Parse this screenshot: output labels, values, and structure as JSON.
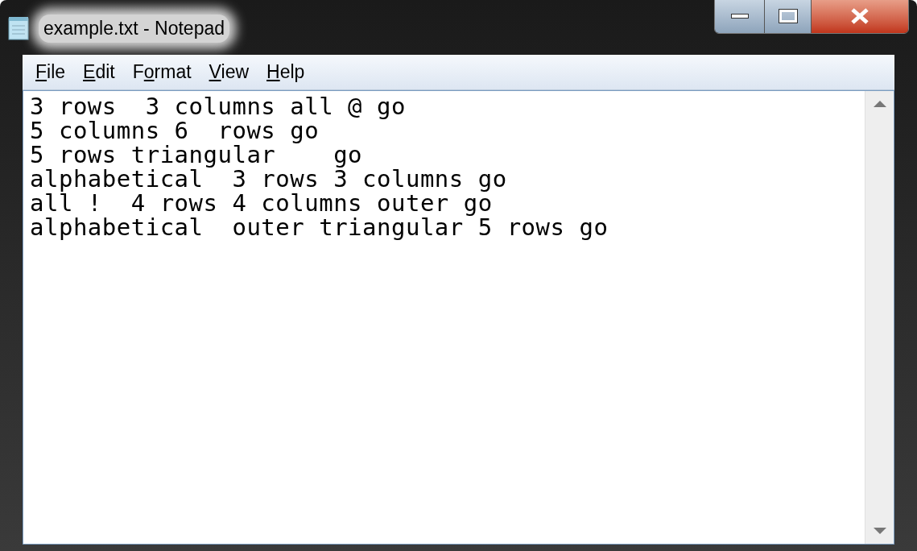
{
  "window": {
    "title": "example.txt - Notepad"
  },
  "menu": [
    {
      "key": "F",
      "post": "ile"
    },
    {
      "key": "E",
      "post": "dit"
    },
    {
      "pre": "F",
      "key": "o",
      "post": "rmat"
    },
    {
      "key": "V",
      "post": "iew"
    },
    {
      "key": "H",
      "post": "elp"
    }
  ],
  "editor": {
    "lines": [
      "3 rows  3 columns all @ go",
      "5 columns 6  rows go",
      "5 rows triangular    go",
      "alphabetical  3 rows 3 columns go",
      "all !  4 rows 4 columns outer go",
      "alphabetical  outer triangular 5 rows go"
    ]
  }
}
